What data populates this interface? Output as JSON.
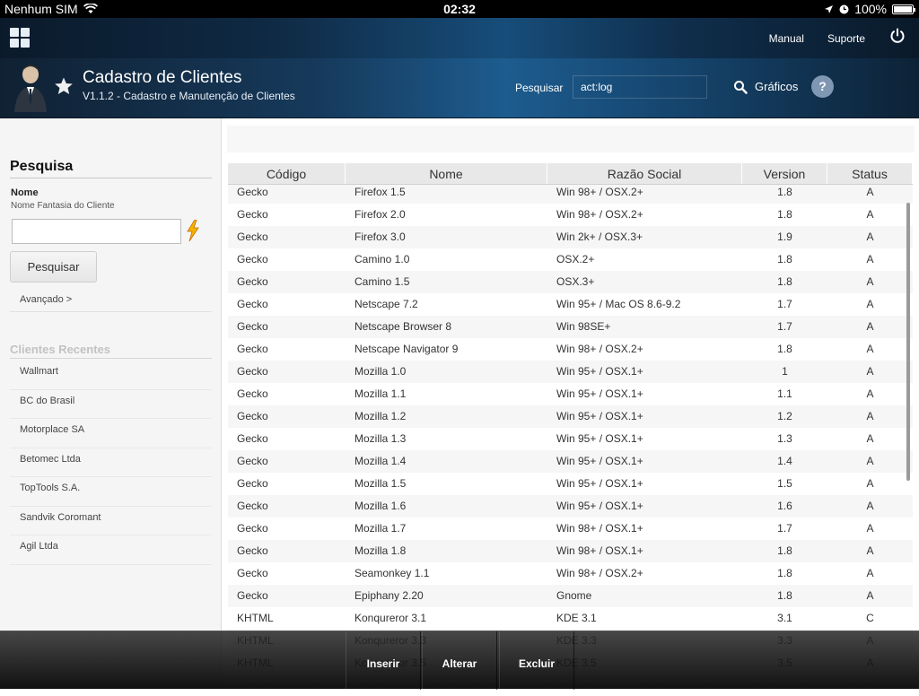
{
  "statusbar": {
    "carrier": "Nenhum SIM",
    "time": "02:32",
    "battery": "100%"
  },
  "topnav": {
    "links": [
      "Manual",
      "Suporte"
    ]
  },
  "header": {
    "title": "Cadastro de Clientes",
    "subtitle": "V1.1.2 - Cadastro e Manutenção de Clientes",
    "search_label": "Pesquisar",
    "search_value": "act:log",
    "charts_label": "Gráficos",
    "help_label": "?"
  },
  "sidebar": {
    "section_title": "Pesquisa",
    "field_label": "Nome",
    "field_hint": "Nome Fantasia do Cliente",
    "search_button": "Pesquisar",
    "advanced_link": "Avançado >",
    "recent_title": "Clientes Recentes",
    "recent_items": [
      "Wallmart",
      "BC do Brasil",
      "Motorplace SA",
      "Betomec Ltda",
      "TopTools S.A.",
      "Sandvik Coromant",
      "Agil Ltda"
    ]
  },
  "table": {
    "columns": [
      "Código",
      "Nome",
      "Razão Social",
      "Version",
      "Status"
    ],
    "rows": [
      [
        "Gecko",
        "Firefox 1.5",
        "Win 98+ / OSX.2+",
        "1.8",
        "A"
      ],
      [
        "Gecko",
        "Firefox 2.0",
        "Win 98+ / OSX.2+",
        "1.8",
        "A"
      ],
      [
        "Gecko",
        "Firefox 3.0",
        "Win 2k+ / OSX.3+",
        "1.9",
        "A"
      ],
      [
        "Gecko",
        "Camino 1.0",
        "OSX.2+",
        "1.8",
        "A"
      ],
      [
        "Gecko",
        "Camino 1.5",
        "OSX.3+",
        "1.8",
        "A"
      ],
      [
        "Gecko",
        "Netscape 7.2",
        "Win 95+ / Mac OS 8.6-9.2",
        "1.7",
        "A"
      ],
      [
        "Gecko",
        "Netscape Browser 8",
        "Win 98SE+",
        "1.7",
        "A"
      ],
      [
        "Gecko",
        "Netscape Navigator 9",
        "Win 98+ / OSX.2+",
        "1.8",
        "A"
      ],
      [
        "Gecko",
        "Mozilla 1.0",
        "Win 95+ / OSX.1+",
        "1",
        "A"
      ],
      [
        "Gecko",
        "Mozilla 1.1",
        "Win 95+ / OSX.1+",
        "1.1",
        "A"
      ],
      [
        "Gecko",
        "Mozilla 1.2",
        "Win 95+ / OSX.1+",
        "1.2",
        "A"
      ],
      [
        "Gecko",
        "Mozilla 1.3",
        "Win 95+ / OSX.1+",
        "1.3",
        "A"
      ],
      [
        "Gecko",
        "Mozilla 1.4",
        "Win 95+ / OSX.1+",
        "1.4",
        "A"
      ],
      [
        "Gecko",
        "Mozilla 1.5",
        "Win 95+ / OSX.1+",
        "1.5",
        "A"
      ],
      [
        "Gecko",
        "Mozilla 1.6",
        "Win 95+ / OSX.1+",
        "1.6",
        "A"
      ],
      [
        "Gecko",
        "Mozilla 1.7",
        "Win 98+ / OSX.1+",
        "1.7",
        "A"
      ],
      [
        "Gecko",
        "Mozilla 1.8",
        "Win 98+ / OSX.1+",
        "1.8",
        "A"
      ],
      [
        "Gecko",
        "Seamonkey 1.1",
        "Win 98+ / OSX.2+",
        "1.8",
        "A"
      ],
      [
        "Gecko",
        "Epiphany 2.20",
        "Gnome",
        "1.8",
        "A"
      ],
      [
        "KHTML",
        "Konqureror 3.1",
        "KDE 3.1",
        "3.1",
        "C"
      ],
      [
        "KHTML",
        "Konqureror 3.3",
        "KDE 3.3",
        "3.3",
        "A"
      ],
      [
        "KHTML",
        "Konqureror 3.5",
        "KDE 3.5",
        "3.5",
        "A"
      ]
    ]
  },
  "toolbar": {
    "buttons": [
      "Inserir",
      "Alterar",
      "Excluir"
    ]
  }
}
